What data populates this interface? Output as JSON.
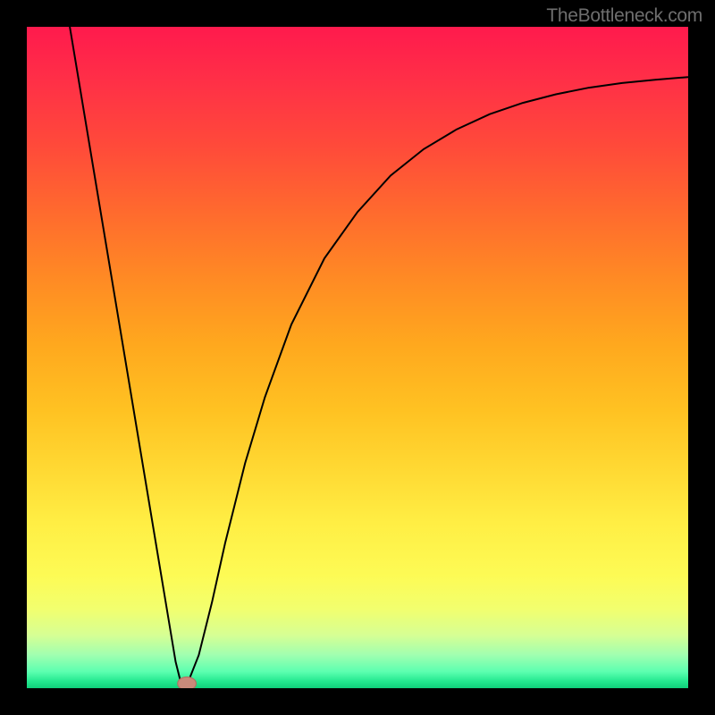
{
  "credit_text": "TheBottleneck.com",
  "colors": {
    "frame": "#000000",
    "line": "#000000",
    "marker_fill": "#c98a7a",
    "marker_stroke": "#b07062"
  },
  "chart_data": {
    "type": "line",
    "title": "",
    "xlabel": "",
    "ylabel": "",
    "xlim": [
      0,
      100
    ],
    "ylim": [
      0,
      100
    ],
    "series": [
      {
        "name": "bottleneck-curve",
        "values": [
          {
            "x": 6.5,
            "y": 100
          },
          {
            "x": 8,
            "y": 91
          },
          {
            "x": 10,
            "y": 79
          },
          {
            "x": 12,
            "y": 67
          },
          {
            "x": 14,
            "y": 55
          },
          {
            "x": 16,
            "y": 43
          },
          {
            "x": 18,
            "y": 31
          },
          {
            "x": 20,
            "y": 19
          },
          {
            "x": 21.5,
            "y": 10
          },
          {
            "x": 22.5,
            "y": 4
          },
          {
            "x": 23.2,
            "y": 1.2
          },
          {
            "x": 23.8,
            "y": 0.5
          },
          {
            "x": 24.5,
            "y": 1.2
          },
          {
            "x": 26,
            "y": 5
          },
          {
            "x": 28,
            "y": 13
          },
          {
            "x": 30,
            "y": 22
          },
          {
            "x": 33,
            "y": 34
          },
          {
            "x": 36,
            "y": 44
          },
          {
            "x": 40,
            "y": 55
          },
          {
            "x": 45,
            "y": 65
          },
          {
            "x": 50,
            "y": 72
          },
          {
            "x": 55,
            "y": 77.5
          },
          {
            "x": 60,
            "y": 81.5
          },
          {
            "x": 65,
            "y": 84.5
          },
          {
            "x": 70,
            "y": 86.8
          },
          {
            "x": 75,
            "y": 88.5
          },
          {
            "x": 80,
            "y": 89.8
          },
          {
            "x": 85,
            "y": 90.8
          },
          {
            "x": 90,
            "y": 91.5
          },
          {
            "x": 95,
            "y": 92
          },
          {
            "x": 100,
            "y": 92.4
          }
        ]
      }
    ],
    "marker": {
      "x": 24.2,
      "y": 0.7,
      "rx": 1.4,
      "ry": 1.0
    }
  }
}
